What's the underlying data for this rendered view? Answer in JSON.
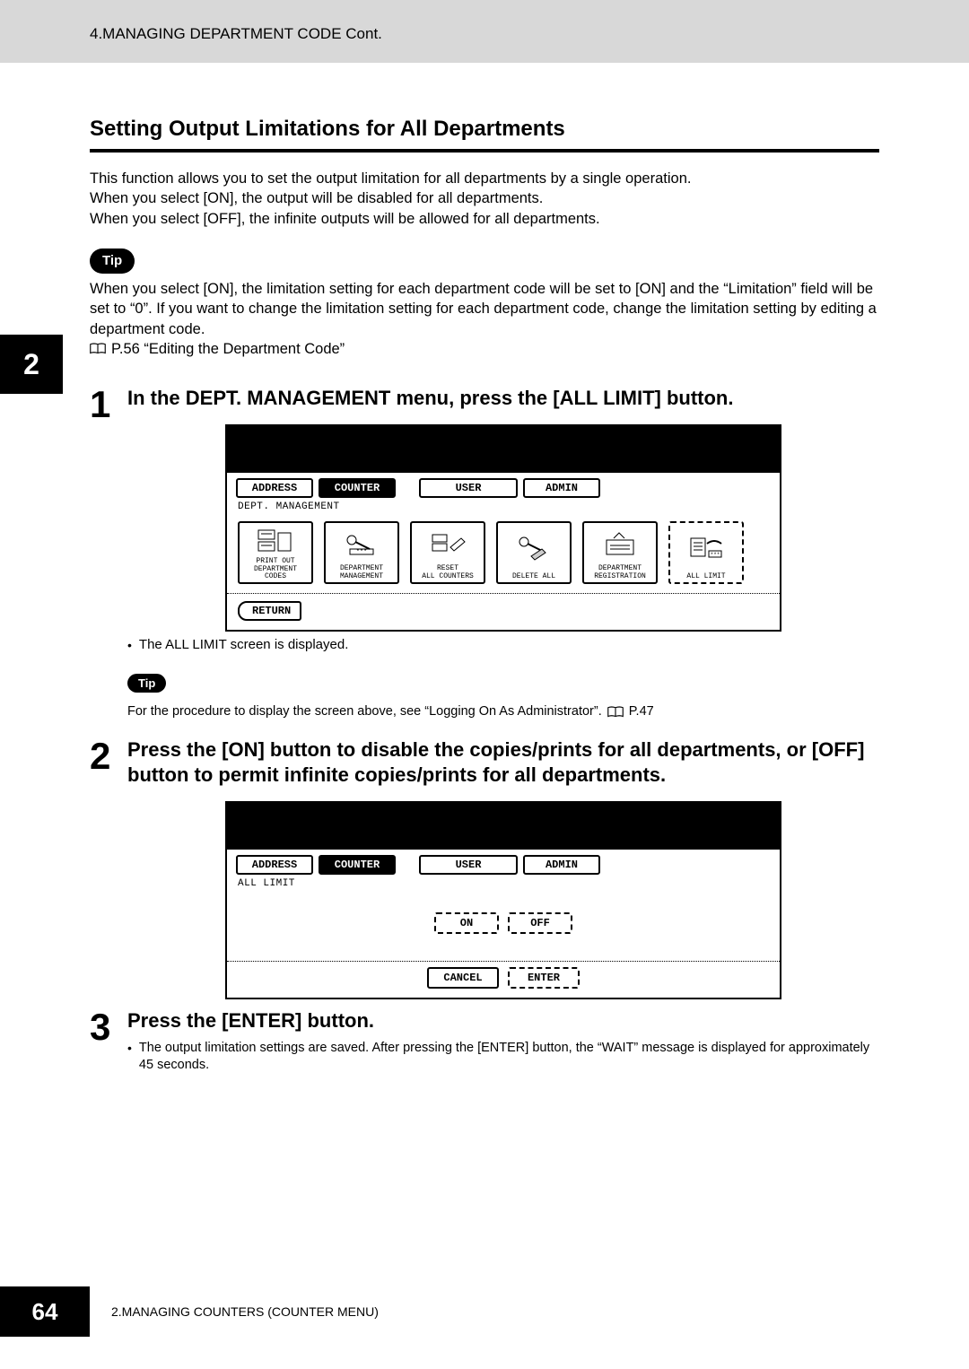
{
  "header": {
    "breadcrumb": "4.MANAGING DEPARTMENT CODE Cont."
  },
  "chapter_tab": "2",
  "section": {
    "title": "Setting Output Limitations for All Departments",
    "intro": {
      "line1": "This function allows you to set the output limitation for all departments by a single operation.",
      "line2": "When you select [ON], the output will be disabled for all departments.",
      "line3": "When you select [OFF], the infinite outputs will be allowed for all departments."
    },
    "tip1": {
      "label": "Tip",
      "text": "When you select [ON], the limitation setting for each department code will be set to [ON] and the “Limitation” field will be set to “0”.  If you want to change the limitation setting for each department code, change the limitation setting by editing a department code.",
      "ref": "P.56 “Editing the Department Code”"
    }
  },
  "steps": {
    "s1": {
      "num": "1",
      "heading": "In the DEPT. MANAGEMENT menu, press the [ALL LIMIT] button.",
      "bullet": "The ALL LIMIT screen is displayed.",
      "tip_label": "Tip",
      "tip_text1": "For the procedure to display the screen above, see “Logging On As Administrator”.",
      "tip_ref": "P.47"
    },
    "s2": {
      "num": "2",
      "heading": "Press the [ON] button to disable the copies/prints for all departments, or [OFF] button to permit infinite copies/prints for all departments."
    },
    "s3": {
      "num": "3",
      "heading": "Press the [ENTER] button.",
      "bullet": "The output limitation settings are saved.  After pressing the [ENTER] button, the “WAIT” message is displayed for approximately 45 seconds."
    }
  },
  "screen1": {
    "tabs": {
      "address": "ADDRESS",
      "counter": "COUNTER",
      "user": "USER",
      "admin": "ADMIN"
    },
    "subheader": "DEPT. MANAGEMENT",
    "buttons": {
      "b1a": "PRINT OUT",
      "b1b": "DEPARTMENT CODES",
      "b2a": "DEPARTMENT",
      "b2b": "MANAGEMENT",
      "b3a": "RESET",
      "b3b": "ALL COUNTERS",
      "b4": "DELETE ALL",
      "b5a": "DEPARTMENT",
      "b5b": "REGISTRATION",
      "b6": "ALL LIMIT"
    },
    "return": "RETURN"
  },
  "screen2": {
    "tabs": {
      "address": "ADDRESS",
      "counter": "COUNTER",
      "user": "USER",
      "admin": "ADMIN"
    },
    "subheader": "ALL LIMIT",
    "on": "ON",
    "off": "OFF",
    "cancel": "CANCEL",
    "enter": "ENTER"
  },
  "footer": {
    "page": "64",
    "text": "2.MANAGING COUNTERS (COUNTER MENU)"
  }
}
